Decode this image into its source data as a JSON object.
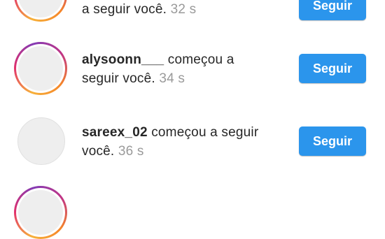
{
  "notifications": [
    {
      "username": "",
      "action_line1": "",
      "action_line2": "a seguir você.",
      "time": "32 s",
      "button_label": "Seguir"
    },
    {
      "username": "alysoonn___",
      "action_line1": " começou a",
      "action_line2": "seguir você.",
      "time": "34 s",
      "button_label": "Seguir"
    },
    {
      "username": "sareex_02",
      "action_line1": " começou a seguir",
      "action_line2": "você.",
      "time": "36 s",
      "button_label": "Seguir"
    }
  ],
  "colors": {
    "follow_button": "#2b95ec",
    "timestamp": "#9a9a9a",
    "story_ring": "#e1306c"
  }
}
